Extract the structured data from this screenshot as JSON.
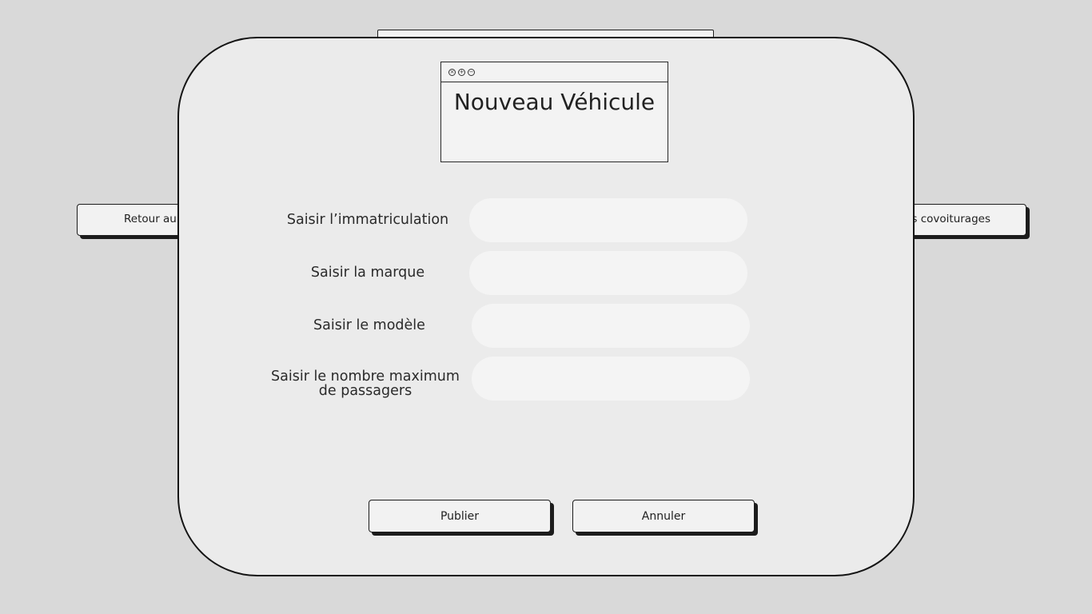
{
  "background_buttons": {
    "left_label": "Retour au",
    "right_label": "s covoiturages"
  },
  "dialog": {
    "title": "Nouveau Véhicule",
    "window_controls": [
      "close-icon",
      "plus-icon",
      "minus-icon"
    ],
    "fields": [
      {
        "label": "Saisir l’immatriculation",
        "value": ""
      },
      {
        "label": "Saisir la marque",
        "value": ""
      },
      {
        "label": "Saisir le modèle",
        "value": ""
      },
      {
        "label_line1": "Saisir le nombre maximum",
        "label_line2": "de passagers",
        "value": ""
      }
    ],
    "publish_label": "Publier",
    "cancel_label": "Annuler"
  },
  "colors": {
    "page_background": "#d9d9d9",
    "panel_background": "#ebebeb",
    "input_background": "#f4f4f4",
    "border": "#141414"
  }
}
